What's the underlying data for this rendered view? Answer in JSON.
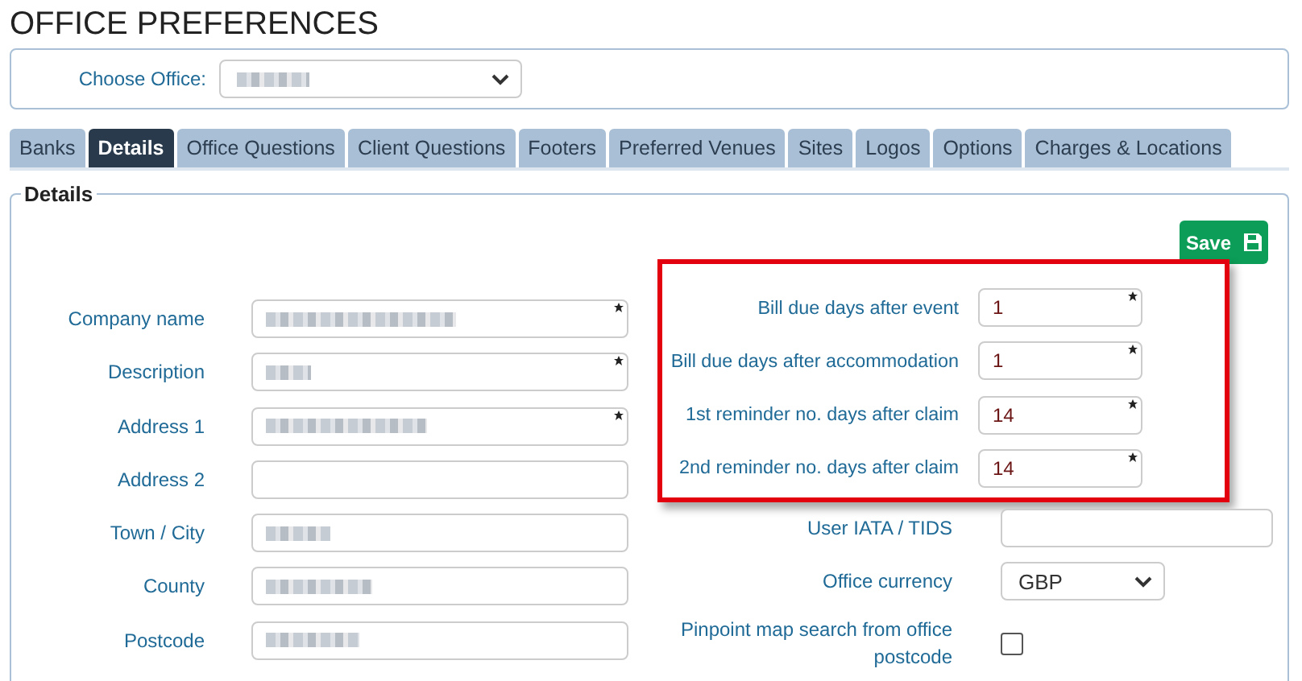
{
  "page_title": "OFFICE PREFERENCES",
  "office_picker": {
    "label": "Choose Office:",
    "redacted": true
  },
  "tabs": [
    {
      "label": "Banks",
      "selected": false
    },
    {
      "label": "Details",
      "selected": true
    },
    {
      "label": "Office Questions",
      "selected": false
    },
    {
      "label": "Client Questions",
      "selected": false
    },
    {
      "label": "Footers",
      "selected": false
    },
    {
      "label": "Preferred Venues",
      "selected": false
    },
    {
      "label": "Sites",
      "selected": false
    },
    {
      "label": "Logos",
      "selected": false
    },
    {
      "label": "Options",
      "selected": false
    },
    {
      "label": "Charges & Locations",
      "selected": false
    }
  ],
  "details": {
    "legend": "Details",
    "save_button": "Save",
    "left_fields": [
      {
        "kind": "text",
        "label": "Company name",
        "required": true,
        "redacted": true
      },
      {
        "kind": "text",
        "label": "Description",
        "required": true,
        "redacted": true
      },
      {
        "kind": "text",
        "label": "Address 1",
        "required": true,
        "redacted": true
      },
      {
        "kind": "text",
        "label": "Address 2",
        "required": false,
        "redacted": false
      },
      {
        "kind": "text",
        "label": "Town / City",
        "required": false,
        "redacted": true
      },
      {
        "kind": "text",
        "label": "County",
        "required": false,
        "redacted": true
      },
      {
        "kind": "text",
        "label": "Postcode",
        "required": false,
        "redacted": true
      }
    ],
    "highlighted_fields": [
      {
        "kind": "text",
        "label": "Bill due days after event",
        "value": "1",
        "required": true
      },
      {
        "kind": "text",
        "label": "Bill due days after accommodation",
        "value": "1",
        "required": true
      },
      {
        "kind": "text",
        "label": "1st reminder no. days after claim",
        "value": "14",
        "required": true
      },
      {
        "kind": "text",
        "label": "2nd reminder no. days after claim",
        "value": "14",
        "required": true
      }
    ],
    "other_fields": [
      {
        "kind": "text",
        "label": "User IATA / TIDS",
        "required": false
      },
      {
        "kind": "select",
        "label": "Office currency",
        "value": "GBP"
      },
      {
        "kind": "checkbox",
        "label": "Pinpoint map search from office postcode",
        "checked": false
      }
    ]
  }
}
